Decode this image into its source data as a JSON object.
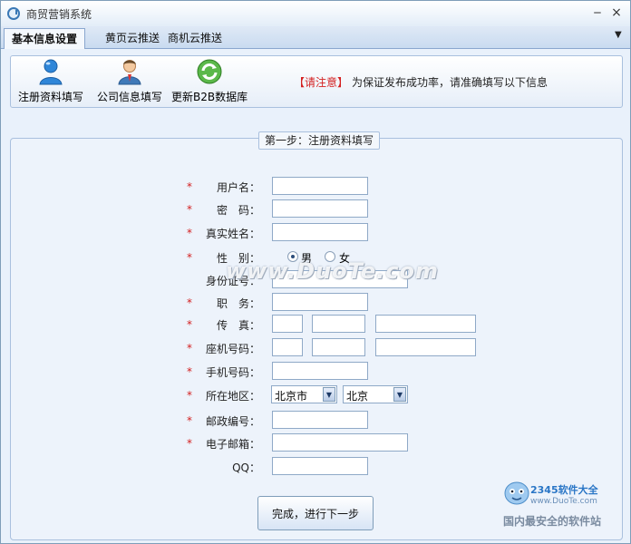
{
  "window": {
    "title": "商贸营销系统",
    "minimize": "‒",
    "close": "×"
  },
  "tabs": [
    {
      "label": "基本信息设置"
    },
    {
      "label": "黄页云推送"
    },
    {
      "label": "商机云推送"
    }
  ],
  "toolbar": {
    "items": [
      {
        "label": "注册资料填写",
        "icon": "user-icon"
      },
      {
        "label": "公司信息填写",
        "icon": "business-person-icon"
      },
      {
        "label": "更新B2B数据库",
        "icon": "refresh-icon"
      }
    ],
    "notice_key": "【请注意】",
    "notice_text": "为保证发布成功率，请准确填写以下信息"
  },
  "form": {
    "legend": "第一步：注册资料填写",
    "fields": {
      "username": "用户名：",
      "password": "密　码：",
      "realname": "真实姓名：",
      "gender": "性　别：",
      "idcard": "身份证号：",
      "position": "职　务：",
      "fax": "传　真：",
      "phone": "座机号码：",
      "mobile": "手机号码：",
      "region": "所在地区：",
      "postcode": "邮政编号：",
      "email": "电子邮箱：",
      "qq": "QQ："
    },
    "star": "*",
    "gender_options": {
      "male": "男",
      "female": "女",
      "selected": "男"
    },
    "region": {
      "province": "北京市",
      "city": "北京"
    },
    "submit_label": "完成，进行下一步"
  },
  "watermark": "www.DuoTe.com",
  "brand": {
    "logo_text": "2345软件大全",
    "site": "www.DuoTe.com",
    "slogan": "国内最安全的软件站"
  },
  "colors": {
    "required_star": "#d31f1f",
    "notice": "#d31f1f",
    "window_bg": "#e9f1fb"
  }
}
